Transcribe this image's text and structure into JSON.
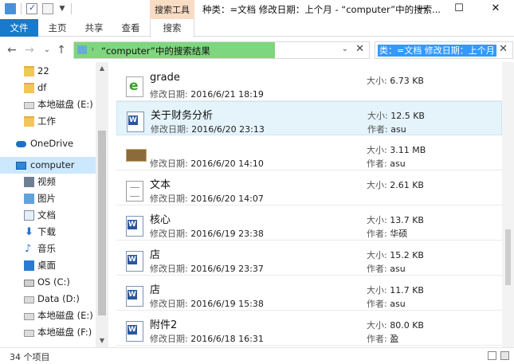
{
  "window": {
    "title": "种类：=文档 修改日期：上个月 - “computer”中的搜索...",
    "context_tab": "搜索工具",
    "minimize": "—",
    "maximize": "☐",
    "close": "✕"
  },
  "ribbon": {
    "tabs": [
      "文件",
      "主页",
      "共享",
      "查看",
      "搜索"
    ]
  },
  "address": {
    "back": "←",
    "forward": "→",
    "recent": "⌄",
    "up": "↑",
    "chevron": "›",
    "crumb": "“computer”中的搜索结果",
    "dropdown": "⌄",
    "close": "✕",
    "progress_pct": 68
  },
  "search": {
    "query": "类：=文档 修改日期：上个月",
    "clear": "✕"
  },
  "nav": {
    "items": [
      {
        "label": "22",
        "icon": "folder-icon"
      },
      {
        "label": "df",
        "icon": "folder-icon"
      },
      {
        "label": "本地磁盘 (E:)",
        "icon": "drive-icon"
      },
      {
        "label": "工作",
        "icon": "folder-icon"
      },
      {
        "label": "OneDrive",
        "icon": "onedrive-icon"
      },
      {
        "label": "computer",
        "icon": "computer-icon",
        "selected": true
      },
      {
        "label": "视频",
        "icon": "videos-icon"
      },
      {
        "label": "图片",
        "icon": "pictures-icon"
      },
      {
        "label": "文档",
        "icon": "documents-icon"
      },
      {
        "label": "下载",
        "icon": "download-icon"
      },
      {
        "label": "音乐",
        "icon": "music-icon"
      },
      {
        "label": "桌面",
        "icon": "desktop-icon"
      },
      {
        "label": "OS (C:)",
        "icon": "os-drive-icon"
      },
      {
        "label": "Data (D:)",
        "icon": "drive-icon"
      },
      {
        "label": "本地磁盘 (E:)",
        "icon": "drive-icon"
      },
      {
        "label": "本地磁盘 (F:)",
        "icon": "drive-icon"
      }
    ],
    "scroll_up": "▲",
    "scroll_down": "▼"
  },
  "labels": {
    "modified": "修改日期:",
    "size": "大小:",
    "author": "作者:"
  },
  "files": [
    {
      "name": "grade",
      "modified": "2016/6/21 18:19",
      "size": "6.73 KB",
      "author": "",
      "icon": "html-file-icon"
    },
    {
      "name": "关于财务分析",
      "modified": "2016/6/20 23:13",
      "size": "12.5 KB",
      "author": "asu",
      "icon": "word-file-icon",
      "highlighted": true
    },
    {
      "name": "",
      "modified": "2016/6/20 14:10",
      "size": "3.11 MB",
      "author": "asu",
      "icon": "image-file-icon"
    },
    {
      "name": "文本",
      "modified": "2016/6/20 14:07",
      "size": "2.61 KB",
      "author": "",
      "icon": "text-file-icon"
    },
    {
      "name": "核心",
      "modified": "2016/6/19 23:38",
      "size": "13.7 KB",
      "author": "华硕",
      "icon": "word-file-icon"
    },
    {
      "name": "店",
      "modified": "2016/6/19 23:37",
      "size": "15.2 KB",
      "author": "asu",
      "icon": "word-file-icon"
    },
    {
      "name": "店",
      "modified": "2016/6/19 15:38",
      "size": "11.7 KB",
      "author": "asu",
      "icon": "word-file-icon"
    },
    {
      "name": "附件2",
      "modified": "2016/6/18 16:31",
      "size": "80.0 KB",
      "author": "盈",
      "icon": "word-file-icon"
    }
  ],
  "status": {
    "count": "34 个项目"
  }
}
